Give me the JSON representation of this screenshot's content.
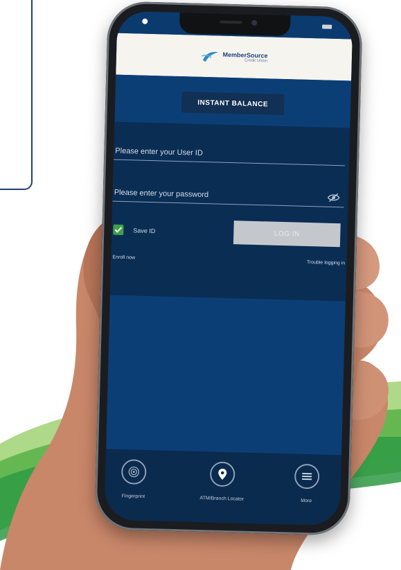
{
  "header": {
    "brand_name": "MemberSource",
    "brand_tagline": "Credit Union"
  },
  "main": {
    "instant_balance_label": "INSTANT BALANCE",
    "user_id_placeholder": "Please enter your User ID",
    "password_placeholder": "Please enter your password",
    "save_id_label": "Save ID",
    "save_id_checked": true,
    "login_label": "LOG IN",
    "enroll_label": "Enroll now",
    "trouble_label": "Trouble logging in"
  },
  "bottom_nav": {
    "items": [
      {
        "label": "Fingerprint",
        "icon": "fingerprint-icon"
      },
      {
        "label": "ATM/Branch Locator",
        "icon": "map-pin-icon"
      },
      {
        "label": "More",
        "icon": "menu-icon"
      }
    ]
  },
  "colors": {
    "primary": "#0c3e76",
    "form_bg": "#0a2d54",
    "check_green": "#3fa04a",
    "login_disabled": "#c4c8cd"
  }
}
